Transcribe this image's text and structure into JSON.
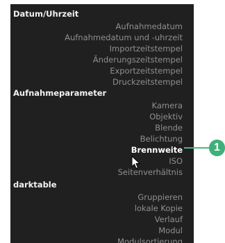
{
  "menu": {
    "sections": [
      {
        "title": "Datum/Uhrzeit",
        "items": [
          "Aufnahmedatum",
          "Aufnahmedatum und -uhrzeit",
          "Importzeitstempel",
          "Änderungszeitstempel",
          "Exportzeitstempel",
          "Druckzeitstempel"
        ]
      },
      {
        "title": "Aufnahmeparameter",
        "items": [
          "Kamera",
          "Objektiv",
          "Blende",
          "Belichtung",
          "Brennweite",
          "ISO",
          "Seitenverhältnis"
        ]
      },
      {
        "title": "darktable",
        "items": [
          "Gruppieren",
          "lokale Kopie",
          "Verlauf",
          "Modul",
          "Modulsortierung"
        ]
      }
    ],
    "active_item": "Brennweite"
  },
  "callout": {
    "number": "1",
    "color": "#3fb07a"
  },
  "colors": {
    "background": "#202020",
    "header_text": "#f2f2f2",
    "item_text": "#8f8f8f",
    "active_text": "#ffffff"
  },
  "icons": {
    "cursor": "mouse-pointer-icon"
  }
}
